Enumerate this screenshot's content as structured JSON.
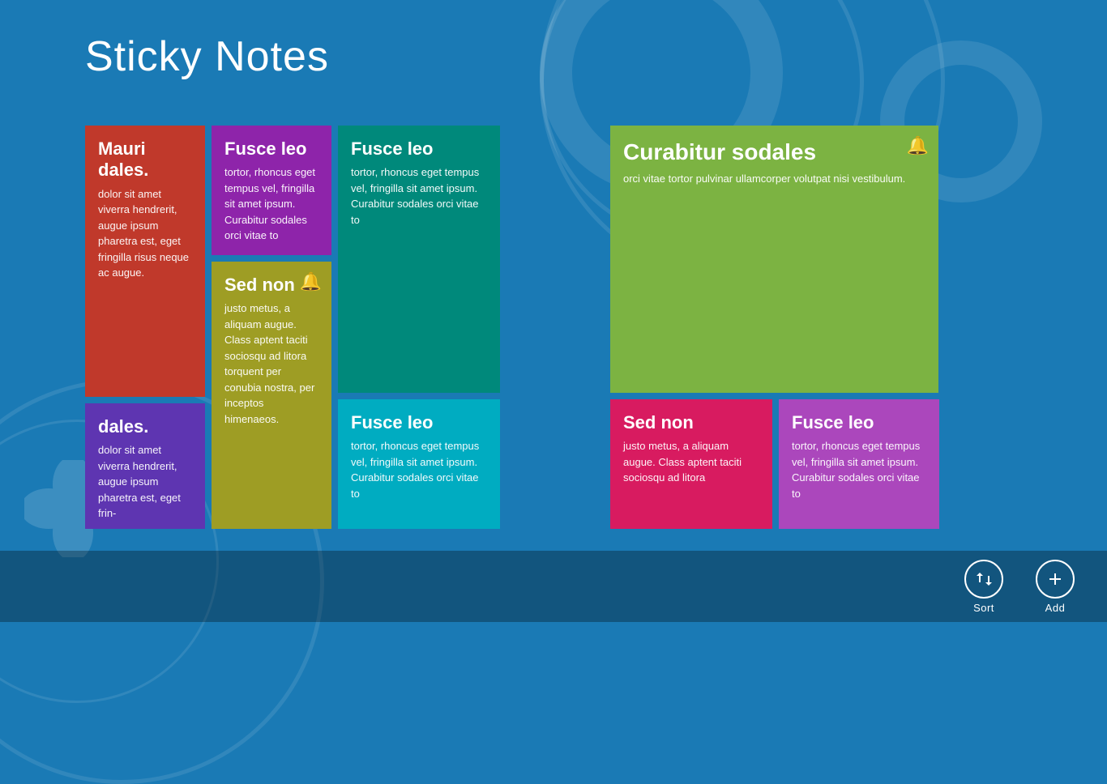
{
  "app": {
    "title": "Sticky Notes",
    "background_color": "#1a7ab5"
  },
  "notes": [
    {
      "id": "note-1",
      "title": "Mauri dales.",
      "body": "dolor sit amet viverra hen- drerit, augue ipsum pharetra est, eget frin- gilla risus neque ac augue.",
      "color": "red",
      "bell": false,
      "size": "tall"
    },
    {
      "id": "note-2",
      "title": "dales.",
      "body": "dolor sit amet viverra hen- drerit, augue ipsum pharetra est, eget frin-",
      "color": "navy-purple",
      "bell": false,
      "size": "small"
    },
    {
      "id": "note-3",
      "title": "Fusce leo",
      "body": "tortor, rhoncus eget tempus vel, fringilla sit amet ipsum. Curabitur sodales orci vitae to",
      "color": "purple",
      "bell": false,
      "size": "medium"
    },
    {
      "id": "note-4",
      "title": "Sed non",
      "body": "justo metus, a aliquam augue. Class aptent taciti sociosqu ad litora torquent per conubia nostra, per inceptos himenaeos.",
      "color": "olive",
      "bell": true,
      "size": "large"
    },
    {
      "id": "note-5",
      "title": "Fusce leo",
      "body": "tortor, rhoncus eget tempus vel, fringilla sit amet ipsum. Curabitur sodales orci vitae to",
      "color": "teal",
      "bell": false,
      "size": "tall"
    },
    {
      "id": "note-6",
      "title": "Fusce leo",
      "body": "tortor, rhoncus eget tempus vel, fringilla sit amet ipsum. Curabitur sodales orci vitae to",
      "color": "teal",
      "bell": false,
      "size": "small"
    },
    {
      "id": "note-7",
      "title": "Curabitur sodales",
      "body": "orci vitae tortor pulvinar ullamcorper volutpat nisi ves- tibulum.",
      "color": "green",
      "bell": true,
      "size": "large"
    },
    {
      "id": "note-8",
      "title": "Sed non",
      "body": "justo metus, a aliquam augue. Class aptent taciti sociosqu ad litora",
      "color": "pink",
      "bell": false,
      "size": "small"
    },
    {
      "id": "note-9",
      "title": "Fusce leo",
      "body": "tortor, rhoncus eget tempus vel, fringilla sit amet ipsum. Curabitur sodales orci vitae to",
      "color": "magenta",
      "bell": false,
      "size": "small"
    }
  ],
  "actions": {
    "sort_label": "Sort",
    "add_label": "Add"
  }
}
